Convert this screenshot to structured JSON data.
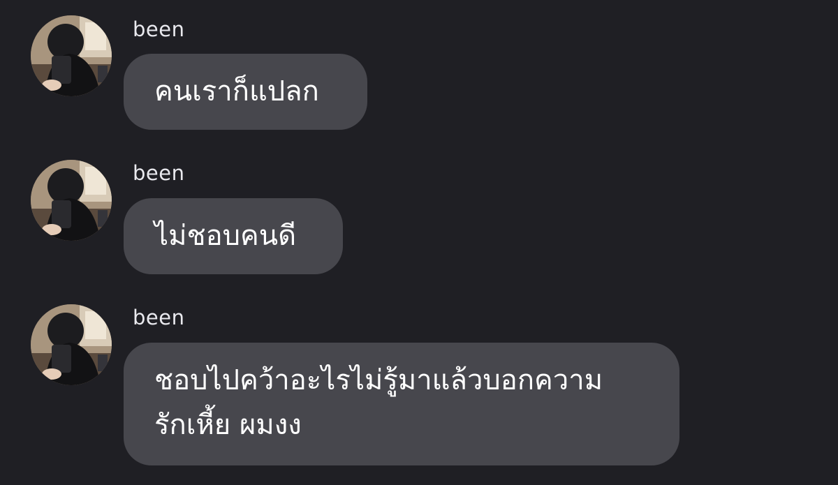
{
  "messages": [
    {
      "sender": "been",
      "text": "คนเราก็แปลก"
    },
    {
      "sender": "been",
      "text": "ไม่ชอบคนดี"
    },
    {
      "sender": "been",
      "text": "ชอบไปคว้าอะไรไม่รู้มาแล้วบอกความ\nรักเหี้ย ผมงง"
    }
  ],
  "colors": {
    "background": "#1f1f24",
    "bubble": "#47474d",
    "text": "#ffffff"
  },
  "icons": {
    "avatar": "user-avatar-photo"
  }
}
